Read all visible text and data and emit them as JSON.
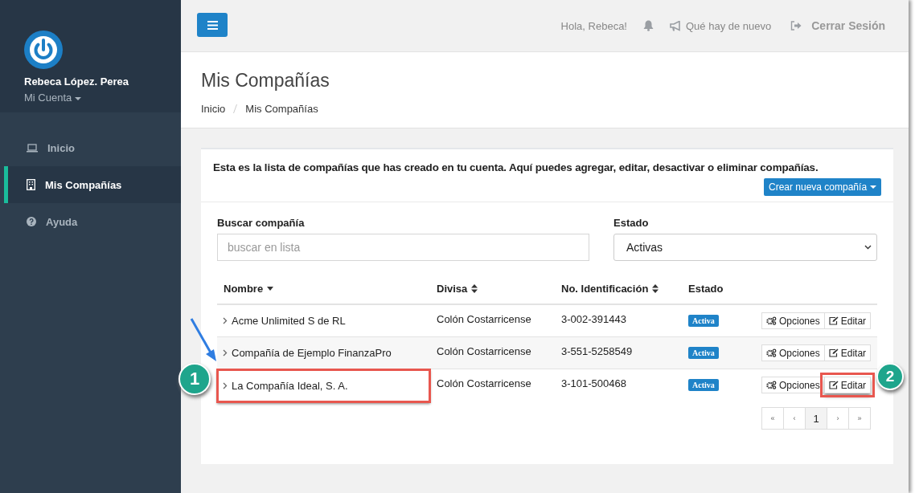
{
  "sidebar": {
    "user_name": "Rebeca López. Perea",
    "account_menu": "Mi Cuenta",
    "items": [
      {
        "label": "Inicio",
        "selected": false
      },
      {
        "label": "Mis Compañías",
        "selected": true
      },
      {
        "label": "Ayuda",
        "selected": false
      }
    ]
  },
  "topbar": {
    "greeting": "Hola, Rebeca!",
    "whats_new": "Qué hay de nuevo",
    "logout": "Cerrar Sesión"
  },
  "page": {
    "title": "Mis Compañías",
    "breadcrumb": [
      "Inicio",
      "Mis Compañías"
    ]
  },
  "card": {
    "description": "Esta es la lista de compañías que has creado en tu cuenta. Aquí puedes agregar, editar, desactivar o eliminar compañías.",
    "create_button": "Crear nueva compañía",
    "search": {
      "label": "Buscar compañía",
      "placeholder": "buscar en lista"
    },
    "status_filter": {
      "label": "Estado",
      "value": "Activas"
    },
    "columns": [
      {
        "label": "Nombre",
        "kind": "sorted"
      },
      {
        "label": "Divisa",
        "kind": "sortable"
      },
      {
        "label": "No. Identificación",
        "kind": "sortable"
      },
      {
        "label": "Estado",
        "kind": "plain"
      }
    ],
    "rows": [
      {
        "name": "Acme Unlimited S de RL",
        "currency": "Colón Costarricense",
        "id": "3-002-391443",
        "status": "Activa",
        "options": "Opciones",
        "edit": "Editar",
        "name_highlighted": false,
        "edit_highlighted": false
      },
      {
        "name": "Compañía de Ejemplo FinanzaPro",
        "currency": "Colón Costarricense",
        "id": "3-551-5258549",
        "status": "Activa",
        "options": "Opciones",
        "edit": "Editar",
        "name_highlighted": false,
        "edit_highlighted": false
      },
      {
        "name": "La Compañía Ideal, S. A.",
        "currency": "Colón Costarricense",
        "id": "3-101-500468",
        "status": "Activa",
        "options": "Opciones",
        "edit": "Editar",
        "name_highlighted": true,
        "edit_highlighted": true
      }
    ],
    "pagination": [
      {
        "label": "«",
        "selected": false
      },
      {
        "label": "‹",
        "selected": false
      },
      {
        "label": "1",
        "selected": true
      },
      {
        "label": "›",
        "selected": false
      },
      {
        "label": "»",
        "selected": false
      }
    ]
  },
  "callouts": [
    "1",
    "2"
  ]
}
